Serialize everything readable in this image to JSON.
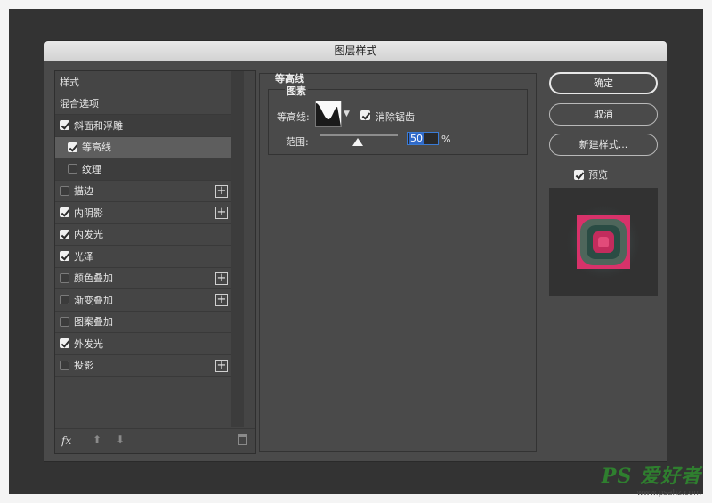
{
  "dialog": {
    "title": "图层样式"
  },
  "style_list": {
    "items": [
      {
        "label": "样式",
        "checkbox": false,
        "checked": false,
        "plus": false,
        "state": "header"
      },
      {
        "label": "混合选项",
        "checkbox": false,
        "checked": false,
        "plus": false,
        "state": "normal"
      },
      {
        "label": "斜面和浮雕",
        "checkbox": true,
        "checked": true,
        "plus": false,
        "state": "parent"
      },
      {
        "label": "等高线",
        "checkbox": true,
        "checked": true,
        "plus": false,
        "state": "selected-sub"
      },
      {
        "label": "纹理",
        "checkbox": true,
        "checked": false,
        "plus": false,
        "state": "sub"
      },
      {
        "label": "描边",
        "checkbox": true,
        "checked": false,
        "plus": true,
        "state": "normal"
      },
      {
        "label": "内阴影",
        "checkbox": true,
        "checked": true,
        "plus": true,
        "state": "normal"
      },
      {
        "label": "内发光",
        "checkbox": true,
        "checked": true,
        "plus": false,
        "state": "normal"
      },
      {
        "label": "光泽",
        "checkbox": true,
        "checked": true,
        "plus": false,
        "state": "normal"
      },
      {
        "label": "颜色叠加",
        "checkbox": true,
        "checked": false,
        "plus": true,
        "state": "normal"
      },
      {
        "label": "渐变叠加",
        "checkbox": true,
        "checked": false,
        "plus": true,
        "state": "normal"
      },
      {
        "label": "图案叠加",
        "checkbox": true,
        "checked": false,
        "plus": false,
        "state": "normal"
      },
      {
        "label": "外发光",
        "checkbox": true,
        "checked": true,
        "plus": false,
        "state": "normal"
      },
      {
        "label": "投影",
        "checkbox": true,
        "checked": false,
        "plus": true,
        "state": "normal"
      }
    ],
    "footer": {
      "fx": "fx"
    }
  },
  "panel": {
    "group_title": "等高线",
    "sub_title": "图素",
    "contour_label": "等高线:",
    "anti_alias_label": "消除锯齿",
    "anti_alias_checked": true,
    "range_label": "范围:",
    "range_value": "50",
    "range_unit": "%",
    "range_percent": 50
  },
  "buttons": {
    "ok": "确定",
    "cancel": "取消",
    "new_style": "新建样式..."
  },
  "preview": {
    "label": "预览",
    "checked": true
  },
  "watermark": {
    "brand": "PS 爱好者",
    "url": "www.psahz.com"
  }
}
